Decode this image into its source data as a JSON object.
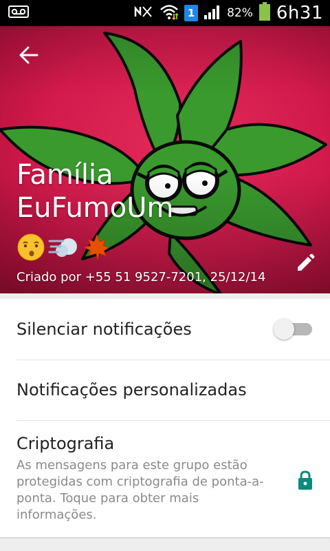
{
  "status_bar": {
    "sim_slot": "1",
    "battery": "82%",
    "time": "6h31"
  },
  "header": {
    "group_name": "Família EuFumoUm",
    "created_by": "Criado por +55 51 9527-7201, 25/12/14"
  },
  "settings": {
    "mute_label": "Silenciar notificações",
    "mute_enabled": false,
    "custom_notifications_label": "Notificações personalizadas",
    "encryption_title": "Criptografia",
    "encryption_desc": "As mensagens para este grupo estão protegidas com criptografia de ponta-a-ponta. Toque para obter mais informações."
  },
  "colors": {
    "header_bg": "#d21a4c",
    "leaf_green": "#3a9a2e",
    "lock_teal": "#0d8a7c"
  }
}
